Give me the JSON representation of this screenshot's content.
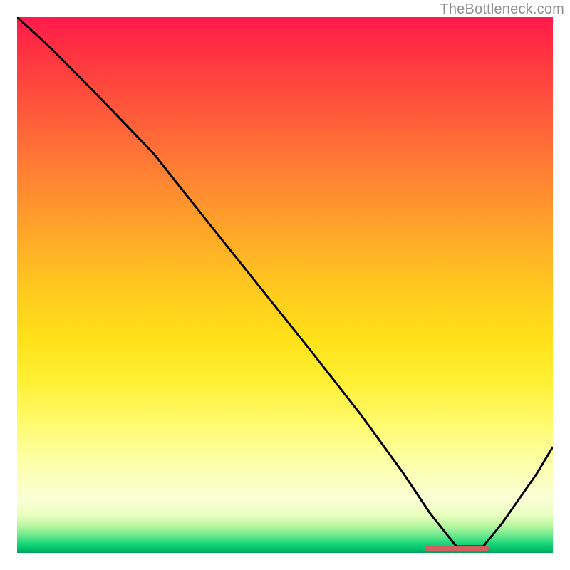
{
  "watermark": "TheBottleneck.com",
  "colors": {
    "curve_stroke": "#000000",
    "marker": "#d1605e"
  },
  "marker": {
    "x_start_frac": 0.76,
    "x_end_frac": 0.88,
    "y_frac": 0.992,
    "thickness_px": 7
  },
  "chart_data": {
    "type": "line",
    "title": "",
    "xlabel": "",
    "ylabel": "",
    "xlim": [
      0,
      1
    ],
    "ylim": [
      0,
      1
    ],
    "x": [
      0.0,
      0.06,
      0.12,
      0.18,
      0.255,
      0.35,
      0.45,
      0.55,
      0.64,
      0.72,
      0.77,
      0.82,
      0.87,
      0.905,
      0.94,
      0.97,
      1.0
    ],
    "values": [
      1.0,
      0.945,
      0.885,
      0.823,
      0.745,
      0.625,
      0.5,
      0.375,
      0.26,
      0.15,
      0.075,
      0.012,
      0.012,
      0.055,
      0.105,
      0.148,
      0.198
    ],
    "annotations": []
  }
}
